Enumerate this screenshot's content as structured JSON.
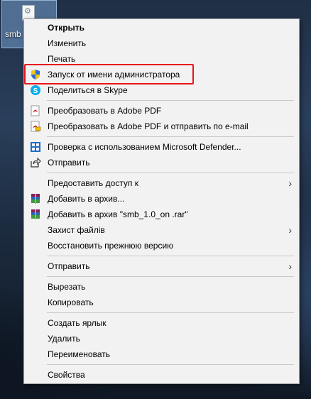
{
  "desktop": {
    "icon_label": "smb"
  },
  "menu": {
    "items": [
      {
        "label": "Открыть",
        "bold": true
      },
      {
        "label": "Изменить"
      },
      {
        "label": "Печать"
      },
      {
        "label": "Запуск от имени администратора",
        "icon": "uac-shield-icon"
      },
      {
        "label": "Поделиться в Skype",
        "icon": "skype-icon"
      },
      {
        "label": "Преобразовать в Adobe PDF",
        "icon": "adobe-pdf-icon"
      },
      {
        "label": "Преобразовать в Adobe PDF и отправить по e-mail",
        "icon": "adobe-pdf-mail-icon"
      },
      {
        "label": "Проверка с использованием Microsoft Defender...",
        "icon": "defender-icon"
      },
      {
        "label": "Отправить",
        "icon": "share-icon"
      },
      {
        "label": "Предоставить доступ к",
        "submenu": true
      },
      {
        "label": "Добавить в архив...",
        "icon": "winrar-icon"
      },
      {
        "label": "Добавить в архив \"smb_1.0_on .rar\"",
        "icon": "winrar-icon"
      },
      {
        "label": "Захист файлів",
        "submenu": true
      },
      {
        "label": "Восстановить прежнюю версию"
      },
      {
        "label": "Отправить",
        "submenu": true
      },
      {
        "label": "Вырезать"
      },
      {
        "label": "Копировать"
      },
      {
        "label": "Создать ярлык"
      },
      {
        "label": "Удалить"
      },
      {
        "label": "Переименовать"
      },
      {
        "label": "Свойства"
      }
    ],
    "highlight_color": "#e8141c"
  }
}
